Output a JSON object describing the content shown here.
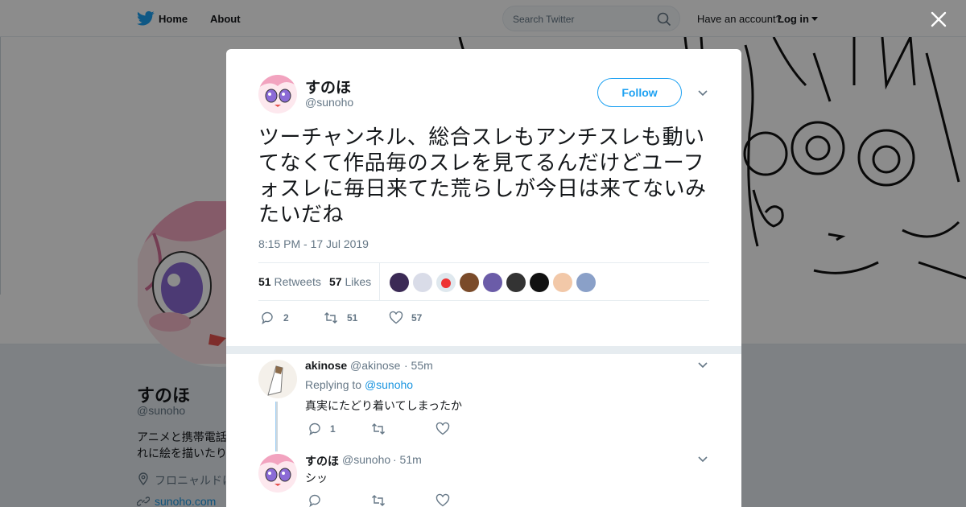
{
  "nav": {
    "home_label": "Home",
    "about_label": "About",
    "search_placeholder": "Search Twitter",
    "have_account": "Have an account?",
    "login_label": "Log in"
  },
  "profile": {
    "name": "すのほ",
    "handle": "@sunoho",
    "bio": "アニメと携帯電話\nれに絵を描いたり",
    "location": "フロニャルドに",
    "url": "sunoho.com"
  },
  "tweet": {
    "author_name": "すのほ",
    "author_handle": "@sunoho",
    "follow_label": "Follow",
    "text": "ツーチャンネル、総合スレもアンチスレも動いてなくて作品毎のスレを見てるんだけどユーフォスレに毎日来てた荒らしが今日は来てないみたいだね",
    "timestamp": "8:15 PM - 17 Jul 2019",
    "retweets_count": "51",
    "retweets_label": "Retweets",
    "likes_count": "57",
    "likes_label": "Likes",
    "actions": {
      "reply": "2",
      "retweet": "51",
      "like": "57"
    }
  },
  "replies": [
    {
      "name": "akinose",
      "handle": "@akinose",
      "time": "· 55m",
      "replying_prefix": "Replying to",
      "replying_to": "@sunoho",
      "text": "真実にたどり着いてしまったか",
      "reply_count": "1"
    },
    {
      "name": "すのほ",
      "handle": "@sunoho",
      "time": "· 51m",
      "text": "シッ"
    }
  ],
  "colors": {
    "accent": "#1da1f2",
    "link": "#1b95e0",
    "muted": "#657786"
  }
}
